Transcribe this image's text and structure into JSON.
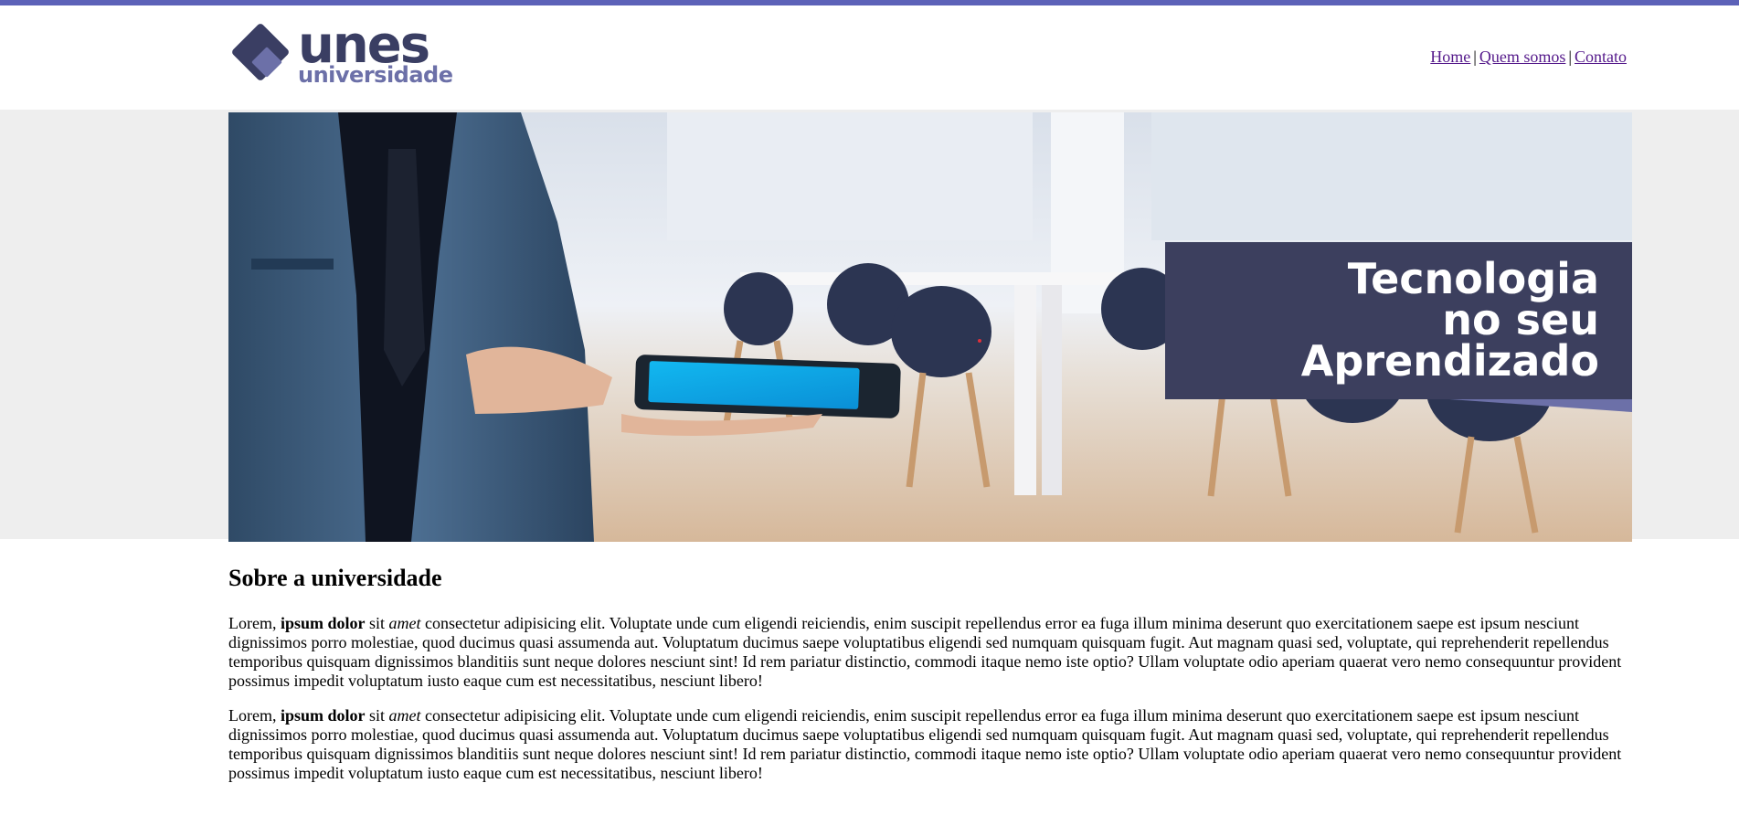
{
  "brand": {
    "name": "unes",
    "subtitle": "universidade",
    "colors": {
      "primary": "#3a3e63",
      "accent": "#6c70a8",
      "topbar": "#5c62b8"
    }
  },
  "nav": {
    "items": [
      {
        "label": "Home"
      },
      {
        "label": "Quem somos"
      },
      {
        "label": "Contato"
      }
    ],
    "separator": "|"
  },
  "banner": {
    "line1": "Tecnologia",
    "line2": "no seu",
    "line3": "Aprendizado"
  },
  "content": {
    "heading": "Sobre a universidade",
    "paragraphs": [
      {
        "p1": "Lorem, ",
        "bold": "ipsum dolor",
        "p2": " sit ",
        "italic": "amet",
        "p3": " consectetur adipisicing elit. Voluptate unde cum eligendi reiciendis, enim suscipit repellendus error ea fuga illum minima deserunt quo exercitationem saepe est ipsum nesciunt dignissimos porro molestiae, quod ducimus quasi assumenda aut. Voluptatum ducimus saepe voluptatibus eligendi sed numquam quisquam fugit. Aut magnam quasi sed, voluptate, qui reprehenderit repellendus temporibus quisquam dignissimos blanditiis sunt neque dolores nesciunt sint! Id rem pariatur distinctio, commodi itaque nemo iste optio? Ullam voluptate odio aperiam quaerat vero nemo consequuntur provident possimus impedit voluptatum iusto eaque cum est necessitatibus, nesciunt libero!"
      },
      {
        "p1": "Lorem, ",
        "bold": "ipsum dolor",
        "p2": " sit ",
        "italic": "amet",
        "p3": " consectetur adipisicing elit. Voluptate unde cum eligendi reiciendis, enim suscipit repellendus error ea fuga illum minima deserunt quo exercitationem saepe est ipsum nesciunt dignissimos porro molestiae, quod ducimus quasi assumenda aut. Voluptatum ducimus saepe voluptatibus eligendi sed numquam quisquam fugit. Aut magnam quasi sed, voluptate, qui reprehenderit repellendus temporibus quisquam dignissimos blanditiis sunt neque dolores nesciunt sint! Id rem pariatur distinctio, commodi itaque nemo iste optio? Ullam voluptate odio aperiam quaerat vero nemo consequuntur provident possimus impedit voluptatum iusto eaque cum est necessitatibus, nesciunt libero!"
      }
    ]
  }
}
